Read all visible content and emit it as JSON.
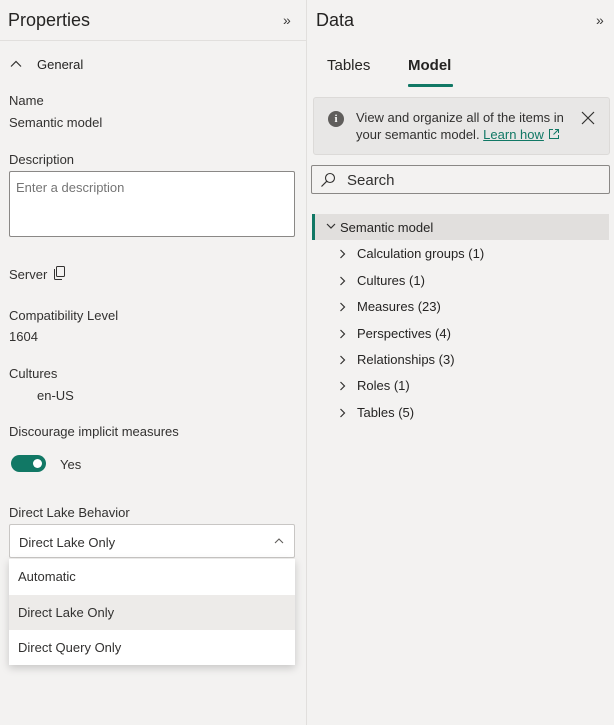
{
  "properties": {
    "title": "Properties",
    "collapse_glyph": "»",
    "section": {
      "label": "General",
      "icon": "chevron-up-icon"
    },
    "name": {
      "label": "Name",
      "value": "Semantic model"
    },
    "description": {
      "label": "Description",
      "placeholder": "Enter a description",
      "value": ""
    },
    "server": {
      "label": "Server",
      "icon": "copy-icon"
    },
    "compatibility": {
      "label": "Compatibility Level",
      "value": "1604"
    },
    "cultures": {
      "label": "Cultures",
      "value": "en-US"
    },
    "implicit_measures": {
      "label": "Discourage implicit measures",
      "toggle_on": true,
      "toggle_text": "Yes"
    },
    "direct_lake": {
      "label": "Direct Lake Behavior",
      "selected": "Direct Lake Only",
      "options": [
        "Automatic",
        "Direct Lake Only",
        "Direct Query Only"
      ],
      "expanded": true
    }
  },
  "data_pane": {
    "title": "Data",
    "collapse_glyph": "»",
    "tabs": [
      {
        "label": "Tables",
        "active": false
      },
      {
        "label": "Model",
        "active": true
      }
    ],
    "info": {
      "text": "View and organize all of the items in your semantic model. ",
      "link": "Learn how",
      "icon": "info-icon",
      "close_icon": "close-icon"
    },
    "search": {
      "placeholder": "Search"
    },
    "tree": {
      "root": "Semantic model",
      "items": [
        "Calculation groups (1)",
        "Cultures (1)",
        "Measures (23)",
        "Perspectives (4)",
        "Relationships (3)",
        "Roles (1)",
        "Tables (5)"
      ]
    }
  },
  "colors": {
    "accent": "#117865",
    "pane_background": "#f3f2f1",
    "selected_item": "#edebe9"
  }
}
